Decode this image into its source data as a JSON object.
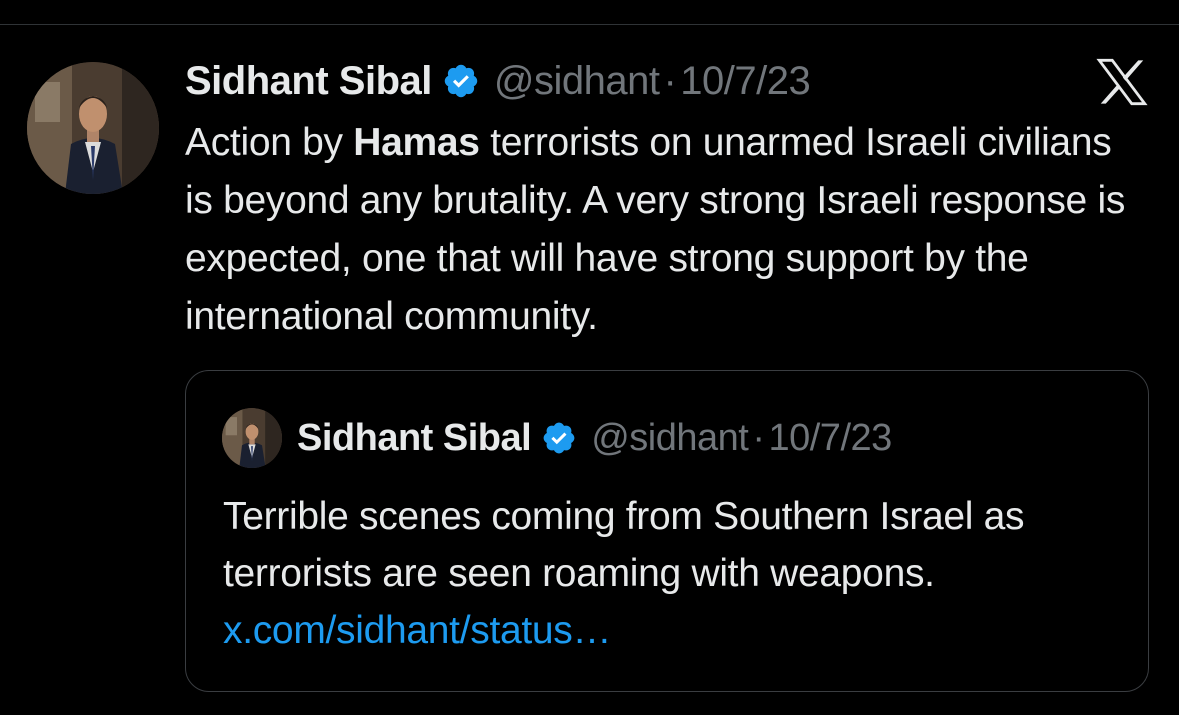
{
  "tweet": {
    "author_name": "Sidhant Sibal",
    "handle": "@sidhant",
    "separator": "·",
    "date": "10/7/23",
    "text_before": "Action by ",
    "text_bold": "Hamas",
    "text_after": " terrorists on unarmed Israeli civilians is beyond any brutality. A very strong Israeli response is expected, one that will have strong support by the international community."
  },
  "quoted_tweet": {
    "author_name": "Sidhant Sibal",
    "handle": "@sidhant",
    "separator": "·",
    "date": "10/7/23",
    "text": "Terrible scenes coming from Southern Israel as terrorists are seen roaming with weapons. ",
    "link_text": "x.com/sidhant/status…"
  },
  "icons": {
    "verified": "verified-badge-icon",
    "logo": "x-logo-icon"
  },
  "colors": {
    "background": "#000000",
    "text": "#e7e9ea",
    "muted": "#71767b",
    "link": "#1d9bf0",
    "verified": "#1d9bf0",
    "border": "#3a3d41"
  }
}
